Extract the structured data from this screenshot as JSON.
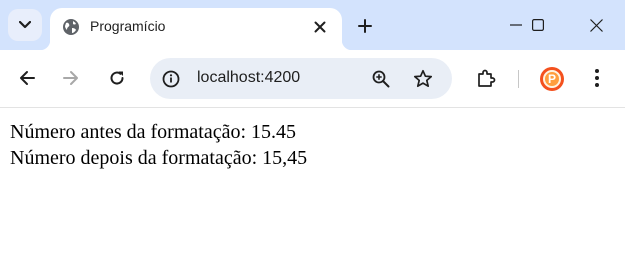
{
  "browser": {
    "tab": {
      "title": "Programício"
    },
    "address_bar": {
      "url": "localhost:4200"
    },
    "profile_letter": "P",
    "colors": {
      "tabstrip": "#d3e3fd",
      "omnibox": "#e9eef6",
      "profile": "#f4511e"
    }
  },
  "page": {
    "before_label": "Número antes da formatação: 15.45",
    "after_label": "Número depois da formatação: 15,45"
  }
}
